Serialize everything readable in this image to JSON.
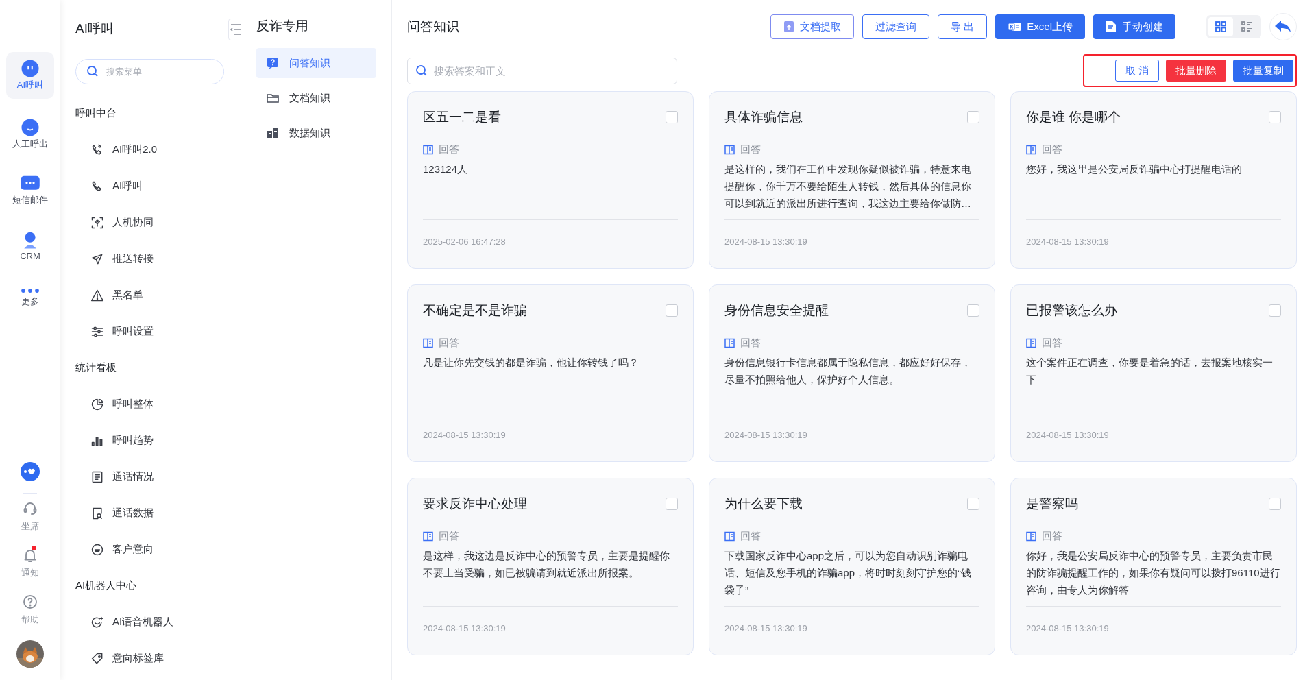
{
  "rail": {
    "items": [
      {
        "label": "AI呼叫",
        "selected": true
      },
      {
        "label": "人工呼出",
        "selected": false
      },
      {
        "label": "短信邮件",
        "selected": false
      },
      {
        "label": "CRM",
        "selected": false
      },
      {
        "label": "更多",
        "selected": false
      }
    ],
    "bottom": [
      {
        "label": "坐席",
        "badge": false
      },
      {
        "label": "通知",
        "badge": true
      },
      {
        "label": "帮助",
        "badge": false
      }
    ]
  },
  "sidebar": {
    "title": "AI呼叫",
    "search": {
      "placeholder": "搜索菜单"
    },
    "sections": [
      {
        "heading": "呼叫中台",
        "items": [
          "AI呼叫2.0",
          "AI呼叫",
          "人机协同",
          "推送转接",
          "黑名单",
          "呼叫设置"
        ]
      },
      {
        "heading": "统计看板",
        "items": [
          "呼叫整体",
          "呼叫趋势",
          "通话情况",
          "通话数据",
          "客户意向"
        ]
      },
      {
        "heading": "AI机器人中心",
        "items": [
          "AI语音机器人",
          "意向标签库"
        ]
      }
    ]
  },
  "subnav": {
    "title": "反诈专用",
    "items": [
      {
        "label": "问答知识",
        "selected": true
      },
      {
        "label": "文档知识",
        "selected": false
      },
      {
        "label": "数据知识",
        "selected": false
      }
    ]
  },
  "main": {
    "title": "问答知识",
    "toolbar": [
      {
        "label": "文档提取",
        "kind": "gradient"
      },
      {
        "label": "过滤查询",
        "kind": "outline"
      },
      {
        "label": "导 出",
        "kind": "outline"
      },
      {
        "label": "Excel上传",
        "kind": "primary"
      },
      {
        "label": "手动创建",
        "kind": "primary"
      }
    ],
    "view_toggle": [
      {
        "selected": true
      },
      {
        "selected": false
      }
    ],
    "search": {
      "placeholder": "搜索答案和正文"
    },
    "batch": [
      {
        "label": "取 消",
        "kind": "outline"
      },
      {
        "label": "批量删除",
        "kind": "danger"
      },
      {
        "label": "批量复制",
        "kind": "primary"
      }
    ],
    "cards": [
      {
        "title": "区五一二是看",
        "label": "回答",
        "body": "123124人",
        "time": "2025-02-06 16:47:28",
        "checked": false
      },
      {
        "title": "具体诈骗信息",
        "label": "回答",
        "body": "是这样的，我们在工作中发现你疑似被诈骗，特意来电提醒你，你千万不要给陌生人转钱，然后具体的信息你可以到就近的派出所进行查询，我这边主要给你做防…",
        "time": "2024-08-15 13:30:19",
        "checked": false
      },
      {
        "title": "你是谁 你是哪个",
        "label": "回答",
        "body": "您好，我这里是公安局反诈骗中心打提醒电话的",
        "time": "2024-08-15 13:30:19",
        "checked": false
      },
      {
        "title": "不确定是不是诈骗",
        "label": "回答",
        "body": "凡是让你先交钱的都是诈骗，他让你转钱了吗？",
        "time": "2024-08-15 13:30:19",
        "checked": false
      },
      {
        "title": "身份信息安全提醒",
        "label": "回答",
        "body": "身份信息银行卡信息都属于隐私信息，都应好好保存，尽量不拍照给他人，保护好个人信息。",
        "time": "2024-08-15 13:30:19",
        "checked": false
      },
      {
        "title": "已报警该怎么办",
        "label": "回答",
        "body": "这个案件正在调查，你要是着急的话，去报案地核实一下",
        "time": "2024-08-15 13:30:19",
        "checked": false
      },
      {
        "title": "要求反诈中心处理",
        "label": "回答",
        "body": "是这样，我这边是反诈中心的预警专员，主要是提醒你不要上当受骗，如已被骗请到就近派出所报案。",
        "time": "2024-08-15 13:30:19",
        "checked": false
      },
      {
        "title": "为什么要下载",
        "label": "回答",
        "body": "下载国家反诈中心app之后，可以为您自动识别诈骗电话、短信及您手机的诈骗app，将时时刻刻守护您的“钱袋子”",
        "time": "2024-08-15 13:30:19",
        "checked": false
      },
      {
        "title": "是警察吗",
        "label": "回答",
        "body": "你好，我是公安局反诈中心的预警专员，主要负责市民的防诈骗提醒工作的，如果你有疑问可以拨打96110进行咨询，由专人为你解答",
        "time": "2024-08-15 13:30:19",
        "checked": false
      }
    ]
  }
}
